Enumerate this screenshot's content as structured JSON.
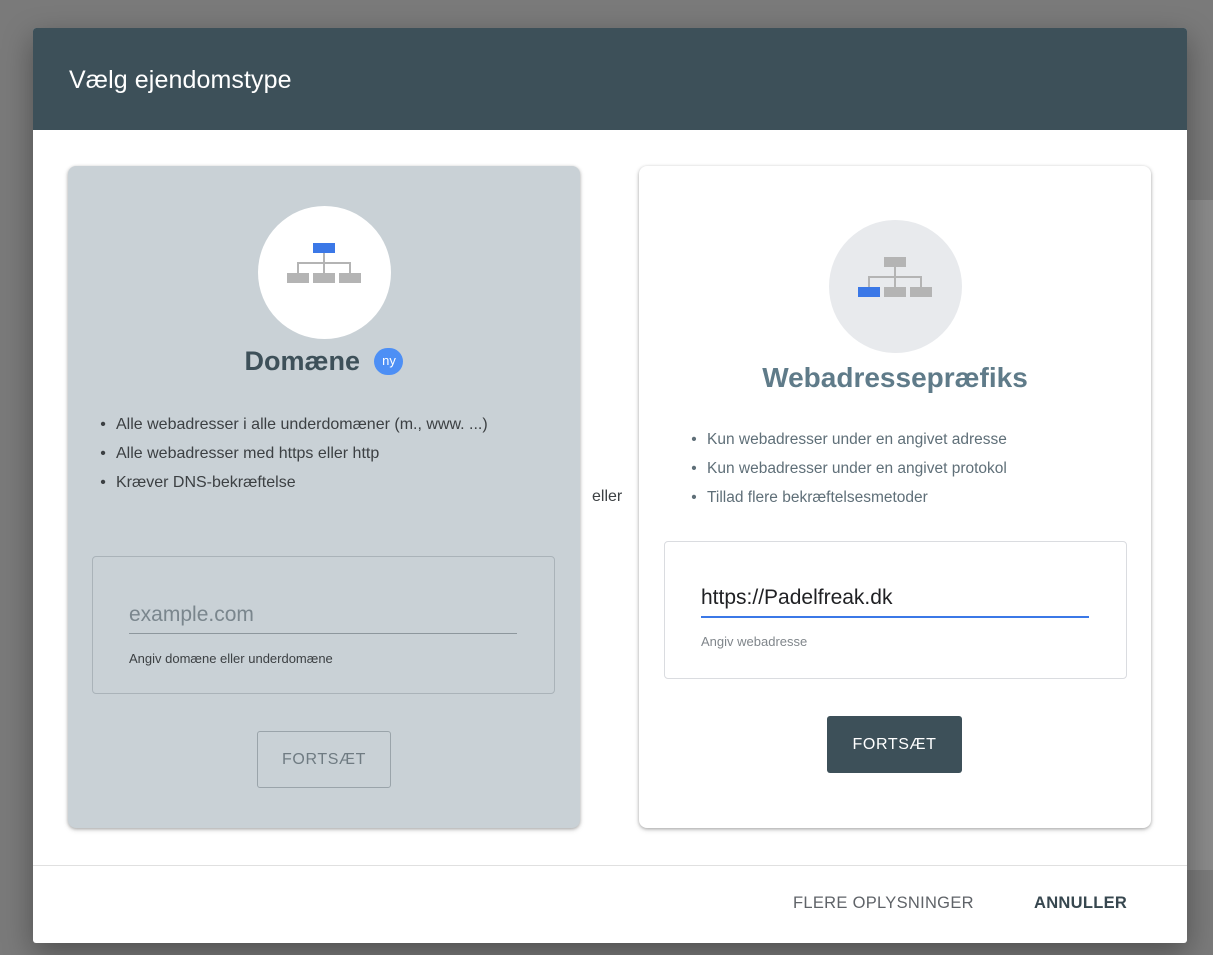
{
  "dialog": {
    "title": "Vælg ejendomstype",
    "separator": "eller"
  },
  "domain_card": {
    "icon": "sitemap-icon",
    "title": "Domæne",
    "badge": "ny",
    "features": [
      "Alle webadresser i alle underdomæner (m., www. ...)",
      "Alle webadresser med https eller http",
      "Kræver DNS-bekræftelse"
    ],
    "input": {
      "value": "",
      "placeholder": "example.com",
      "helper": "Angiv domæne eller underdomæne"
    },
    "continue_label": "FORTSÆT"
  },
  "url_prefix_card": {
    "icon": "sitemap-icon",
    "title": "Webadressepræfiks",
    "features": [
      "Kun webadresser under en angivet adresse",
      "Kun webadresser under en angivet protokol",
      "Tillad flere bekræftelsesmetoder"
    ],
    "input": {
      "value": "https://Padelfreak.dk",
      "helper": "Angiv webadresse"
    },
    "continue_label": "FORTSÆT"
  },
  "footer": {
    "learn_more": "FLERE OPLYSNINGER",
    "cancel": "ANNULLER"
  },
  "colors": {
    "header": "#3d5059",
    "domain_card_bg": "#c9d1d6",
    "accent_blue": "#3b78e7",
    "icon_gray": "#b4b4b4"
  }
}
